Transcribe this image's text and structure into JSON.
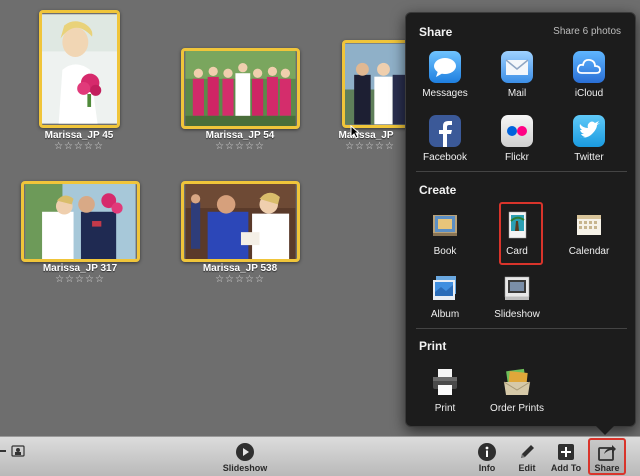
{
  "photos": [
    {
      "caption": "Marissa_JP 45",
      "stars": "☆☆☆☆☆"
    },
    {
      "caption": "Marissa_JP 54",
      "stars": "☆☆☆☆☆"
    },
    {
      "caption": "Marissa_JP",
      "stars": "☆☆☆☆☆"
    },
    {
      "caption": "Marissa_JP 317",
      "stars": "☆☆☆☆☆"
    },
    {
      "caption": "Marissa_JP 538",
      "stars": "☆☆☆☆☆"
    }
  ],
  "popover": {
    "share_title": "Share",
    "share_count": "Share 6 photos",
    "share_items": [
      {
        "label": "Messages",
        "icon": "messages-icon"
      },
      {
        "label": "Mail",
        "icon": "mail-icon"
      },
      {
        "label": "iCloud",
        "icon": "icloud-icon"
      },
      {
        "label": "Facebook",
        "icon": "facebook-icon"
      },
      {
        "label": "Flickr",
        "icon": "flickr-icon"
      },
      {
        "label": "Twitter",
        "icon": "twitter-icon"
      }
    ],
    "create_title": "Create",
    "create_items": [
      {
        "label": "Book",
        "icon": "book-icon"
      },
      {
        "label": "Card",
        "icon": "card-icon",
        "selected": true
      },
      {
        "label": "Calendar",
        "icon": "calendar-icon"
      },
      {
        "label": "Album",
        "icon": "album-icon"
      },
      {
        "label": "Slideshow",
        "icon": "slideshow-icon"
      }
    ],
    "print_title": "Print",
    "print_items": [
      {
        "label": "Print",
        "icon": "printer-icon"
      },
      {
        "label": "Order Prints",
        "icon": "order-prints-icon"
      }
    ]
  },
  "toolbar": {
    "slideshow_label": "Slideshow",
    "info_label": "Info",
    "edit_label": "Edit",
    "add_to_label": "Add To",
    "share_label": "Share"
  },
  "colors": {
    "selection_border": "#f0c53a",
    "highlight_red": "#d9342b",
    "popover_bg": "#1c1c1c",
    "canvas_bg": "#6e6e6e"
  }
}
